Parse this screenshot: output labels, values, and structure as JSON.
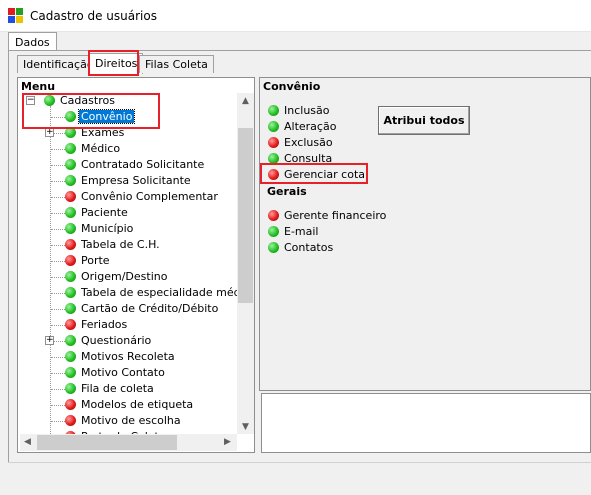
{
  "window": {
    "title": "Cadastro de usuários"
  },
  "outer_tabs": [
    "Dados"
  ],
  "inner_tabs": [
    {
      "label": "Identificação",
      "active": false
    },
    {
      "label": "Direitos",
      "active": true
    },
    {
      "label": "Filas Coleta",
      "active": false
    }
  ],
  "tree": {
    "header": "Menu",
    "root": {
      "label": "Cadastros",
      "status": "green",
      "expanded": true
    },
    "items": [
      {
        "label": "Convênio",
        "status": "green",
        "selected": true,
        "expandable": false
      },
      {
        "label": "Exames",
        "status": "green",
        "expandable": true
      },
      {
        "label": "Médico",
        "status": "green"
      },
      {
        "label": "Contratado Solicitante",
        "status": "green"
      },
      {
        "label": "Empresa Solicitante",
        "status": "green"
      },
      {
        "label": "Convênio Complementar",
        "status": "red"
      },
      {
        "label": "Paciente",
        "status": "green"
      },
      {
        "label": "Município",
        "status": "green"
      },
      {
        "label": "Tabela de C.H.",
        "status": "red"
      },
      {
        "label": "Porte",
        "status": "red"
      },
      {
        "label": "Origem/Destino",
        "status": "green"
      },
      {
        "label": "Tabela de especialidade médica",
        "status": "green"
      },
      {
        "label": "Cartão de Crédito/Débito",
        "status": "green"
      },
      {
        "label": "Feriados",
        "status": "red"
      },
      {
        "label": "Questionário",
        "status": "green",
        "expandable": true
      },
      {
        "label": "Motivos Recoleta",
        "status": "green"
      },
      {
        "label": "Motivo Contato",
        "status": "green"
      },
      {
        "label": "Fila de coleta",
        "status": "green"
      },
      {
        "label": "Modelos de etiqueta",
        "status": "red"
      },
      {
        "label": "Motivo de escolha",
        "status": "red"
      },
      {
        "label": "Porte de Coleta",
        "status": "red"
      }
    ]
  },
  "details": {
    "title": "Convênio",
    "button_label": "Atribui todos",
    "permissions": [
      {
        "label": "Inclusão",
        "status": "green"
      },
      {
        "label": "Alteração",
        "status": "green"
      },
      {
        "label": "Exclusão",
        "status": "red"
      },
      {
        "label": "Consulta",
        "status": "green"
      },
      {
        "label": "Gerenciar cota",
        "status": "red",
        "highlighted": true
      }
    ],
    "general_title": "Gerais",
    "general": [
      {
        "label": "Gerente financeiro",
        "status": "red"
      },
      {
        "label": "E-mail",
        "status": "green"
      },
      {
        "label": "Contatos",
        "status": "green"
      }
    ]
  },
  "colors": {
    "enabled": "#22c022",
    "disabled": "#e21c1c",
    "highlight": "#e8202a",
    "selection": "#0078d7"
  }
}
